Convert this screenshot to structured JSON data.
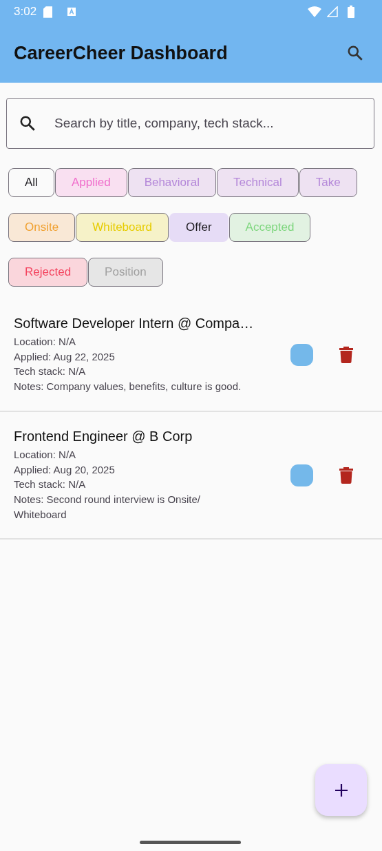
{
  "status_bar": {
    "time": "3:02"
  },
  "app_bar": {
    "title": "CareerCheer Dashboard"
  },
  "search": {
    "placeholder": "Search by title, company, tech stack..."
  },
  "filters": [
    {
      "label": "All",
      "selected": false,
      "kind": "neutral",
      "color": "#1d1b20"
    },
    {
      "label": "Applied",
      "selected": false,
      "kind": "applied",
      "color": "#f06ccb"
    },
    {
      "label": "Behavioral",
      "selected": false,
      "kind": "interview",
      "color": "#b487d9"
    },
    {
      "label": "Technical",
      "selected": false,
      "kind": "interview",
      "color": "#b487d9"
    },
    {
      "label": "Take",
      "selected": false,
      "kind": "interview",
      "color": "#b487d9"
    },
    {
      "label": "Onsite",
      "selected": false,
      "kind": "onsite",
      "color": "#f0a030"
    },
    {
      "label": "Whiteboard",
      "selected": false,
      "kind": "whiteboard",
      "color": "#e6cc00"
    },
    {
      "label": "Offer",
      "selected": true,
      "kind": "neutral",
      "color": "#1d1b20"
    },
    {
      "label": "Accepted",
      "selected": false,
      "kind": "accepted",
      "color": "#7ed67e"
    },
    {
      "label": "Rejected",
      "selected": false,
      "kind": "rejected",
      "color": "#f44560"
    },
    {
      "label": "Position",
      "selected": false,
      "kind": "closed",
      "color": "#a0a0a0"
    }
  ],
  "jobs": [
    {
      "title": "Software Developer Intern @ Compa…",
      "location": "Location: N/A",
      "applied": "Applied: Aug 22, 2025",
      "tech_stack": "Tech stack: N/A",
      "notes": "Notes: Company values, benefits, culture is good."
    },
    {
      "title": "Frontend Engineer @ B Corp",
      "location": "Location: N/A",
      "applied": "Applied: Aug 20, 2025",
      "tech_stack": "Tech stack: N/A",
      "notes": "Notes: Second round interview is Onsite/ Whiteboard"
    }
  ]
}
